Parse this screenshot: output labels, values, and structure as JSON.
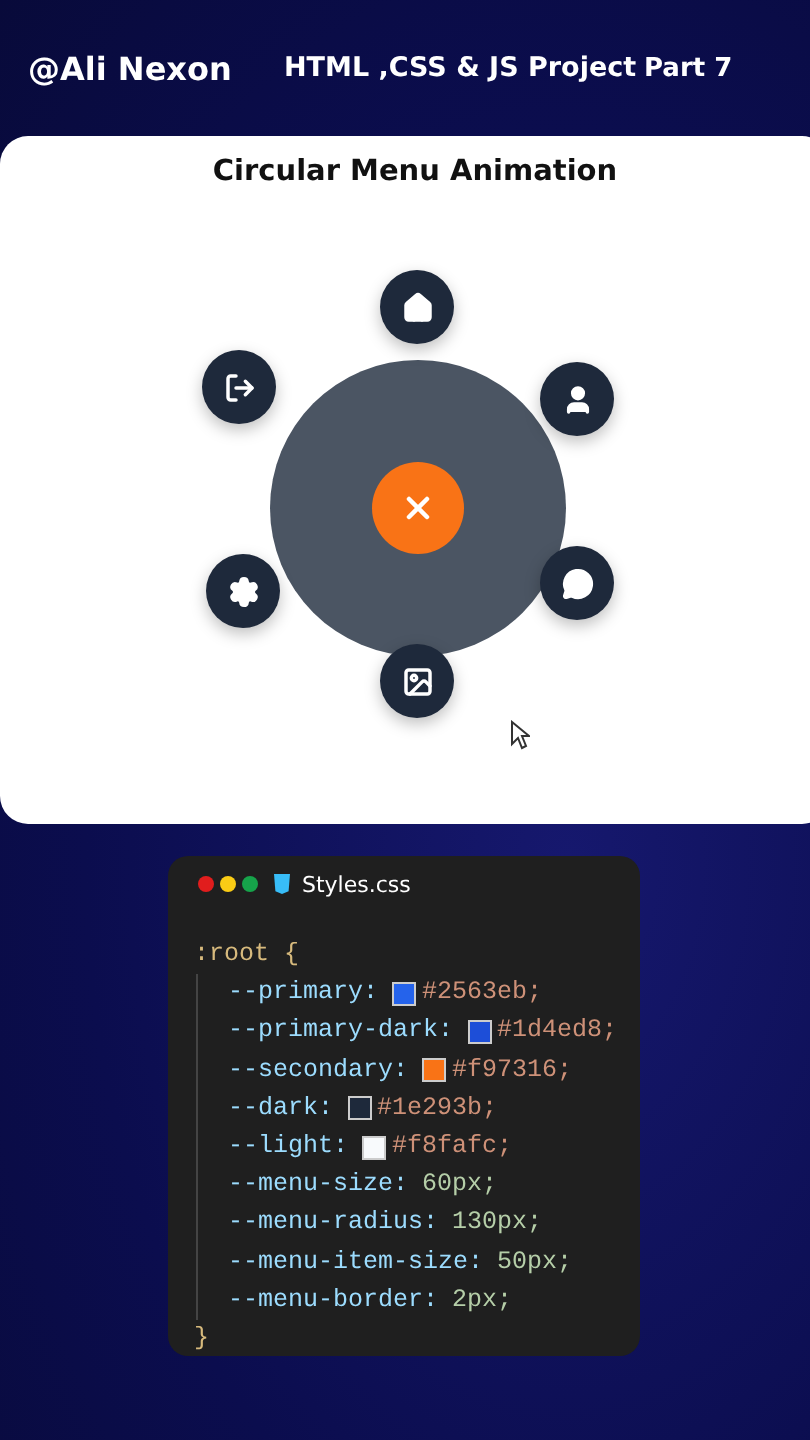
{
  "header": {
    "author": "@Ali Nexon",
    "title": "HTML ,CSS & JS Project",
    "part": "Part 7"
  },
  "demo": {
    "title": "Circular Menu Animation",
    "toggle": {
      "kind": "close",
      "expanded": true
    },
    "items": [
      {
        "kind": "home"
      },
      {
        "kind": "user"
      },
      {
        "kind": "chat"
      },
      {
        "kind": "image"
      },
      {
        "kind": "settings"
      },
      {
        "kind": "logout"
      }
    ]
  },
  "editor": {
    "filename": "Styles.css",
    "selector": ":root {",
    "close": "}",
    "properties": [
      {
        "name": "--primary:",
        "value": "#2563eb;",
        "color": "#2563eb"
      },
      {
        "name": "--primary-dark:",
        "value": "#1d4ed8;",
        "color": "#1d4ed8"
      },
      {
        "name": "--secondary:",
        "value": "#f97316;",
        "color": "#f97316"
      },
      {
        "name": "--dark:",
        "value": "#1e293b;",
        "color": "#1e293b"
      },
      {
        "name": "--light:",
        "value": "#f8fafc;",
        "color": "#f8fafc"
      },
      {
        "name": "--menu-size:",
        "value": "60px;"
      },
      {
        "name": "--menu-radius:",
        "value": "130px;"
      },
      {
        "name": "--menu-item-size:",
        "value": "50px;"
      },
      {
        "name": "--menu-border:",
        "value": "2px;"
      }
    ]
  }
}
